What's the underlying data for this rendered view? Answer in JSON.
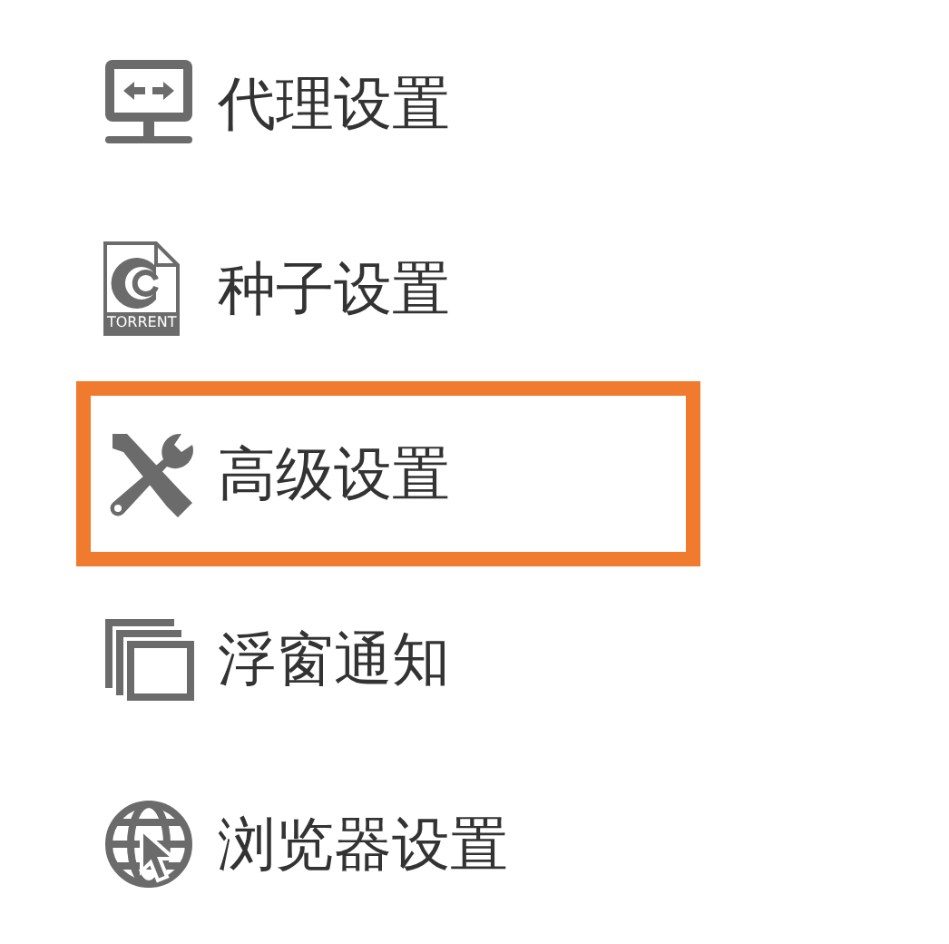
{
  "menu": {
    "items": [
      {
        "kind": "proxy",
        "label": "代理设置",
        "selected": false
      },
      {
        "kind": "torrent",
        "label": "种子设置",
        "icon_label": "TORRENT",
        "selected": false
      },
      {
        "kind": "advanced",
        "label": "高级设置",
        "selected": true
      },
      {
        "kind": "float",
        "label": "浮窗通知",
        "selected": false
      },
      {
        "kind": "browser",
        "label": "浏览器设置",
        "selected": false
      }
    ]
  }
}
